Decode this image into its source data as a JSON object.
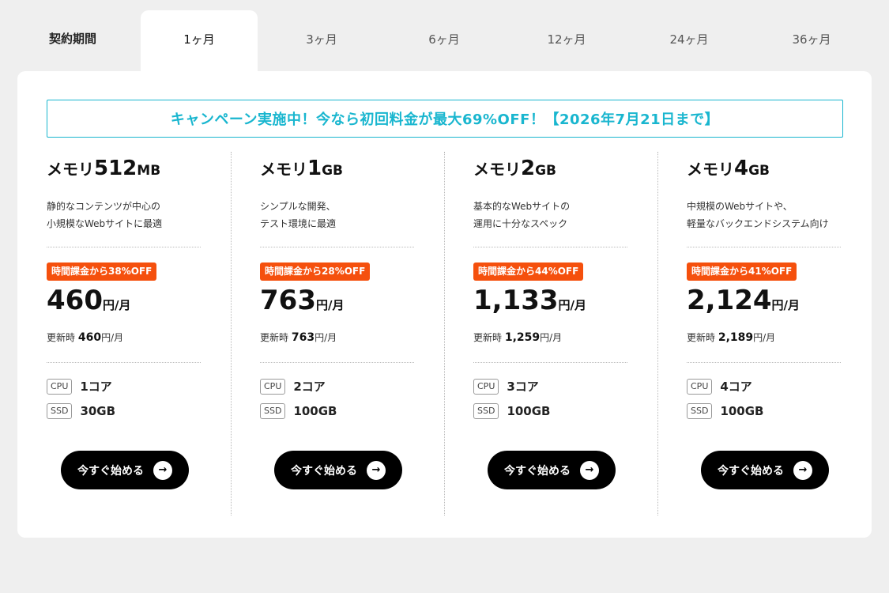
{
  "tabs": {
    "heading": "契約期間",
    "items": [
      {
        "label": "1ヶ月",
        "active": true
      },
      {
        "label": "3ヶ月"
      },
      {
        "label": "6ヶ月"
      },
      {
        "label": "12ヶ月"
      },
      {
        "label": "24ヶ月"
      },
      {
        "label": "36ヶ月"
      }
    ]
  },
  "campaign": "キャンペーン実施中！今なら初回料金が最大69%OFF！【2026年7月21日まで】",
  "plans": [
    {
      "name_prefix": "メモリ",
      "name_num": "512",
      "name_unit": "MB",
      "desc1": "静的なコンテンツが中心の",
      "desc2": "小規模なWebサイトに最適",
      "badge": "時間課金から38%OFF",
      "price": "460",
      "per": "円/月",
      "renew_label": "更新時",
      "renew_price": "460",
      "renew_per": "円/月",
      "cpu_tag": "CPU",
      "cpu": "1コア",
      "ssd_tag": "SSD",
      "ssd": "30GB",
      "cta": "今すぐ始める"
    },
    {
      "name_prefix": "メモリ",
      "name_num": "1",
      "name_unit": "GB",
      "desc1": "シンプルな開発、",
      "desc2": "テスト環境に最適",
      "badge": "時間課金から28%OFF",
      "price": "763",
      "per": "円/月",
      "renew_label": "更新時",
      "renew_price": "763",
      "renew_per": "円/月",
      "cpu_tag": "CPU",
      "cpu": "2コア",
      "ssd_tag": "SSD",
      "ssd": "100GB",
      "cta": "今すぐ始める"
    },
    {
      "name_prefix": "メモリ",
      "name_num": "2",
      "name_unit": "GB",
      "desc1": "基本的なWebサイトの",
      "desc2": "運用に十分なスペック",
      "badge": "時間課金から44%OFF",
      "price": "1,133",
      "per": "円/月",
      "renew_label": "更新時",
      "renew_price": "1,259",
      "renew_per": "円/月",
      "cpu_tag": "CPU",
      "cpu": "3コア",
      "ssd_tag": "SSD",
      "ssd": "100GB",
      "cta": "今すぐ始める"
    },
    {
      "name_prefix": "メモリ",
      "name_num": "4",
      "name_unit": "GB",
      "desc1": "中規模のWebサイトや、",
      "desc2": "軽量なバックエンドシステム向け",
      "badge": "時間課金から41%OFF",
      "price": "2,124",
      "per": "円/月",
      "renew_label": "更新時",
      "renew_price": "2,189",
      "renew_per": "円/月",
      "cpu_tag": "CPU",
      "cpu": "4コア",
      "ssd_tag": "SSD",
      "ssd": "100GB",
      "cta": "今すぐ始める"
    }
  ],
  "colors": {
    "accent": "#19b6cf",
    "badge": "#f5500d",
    "cta": "#000000",
    "background": "#efefef"
  },
  "icons": {
    "cta_arrow": "arrow-right-icon"
  }
}
